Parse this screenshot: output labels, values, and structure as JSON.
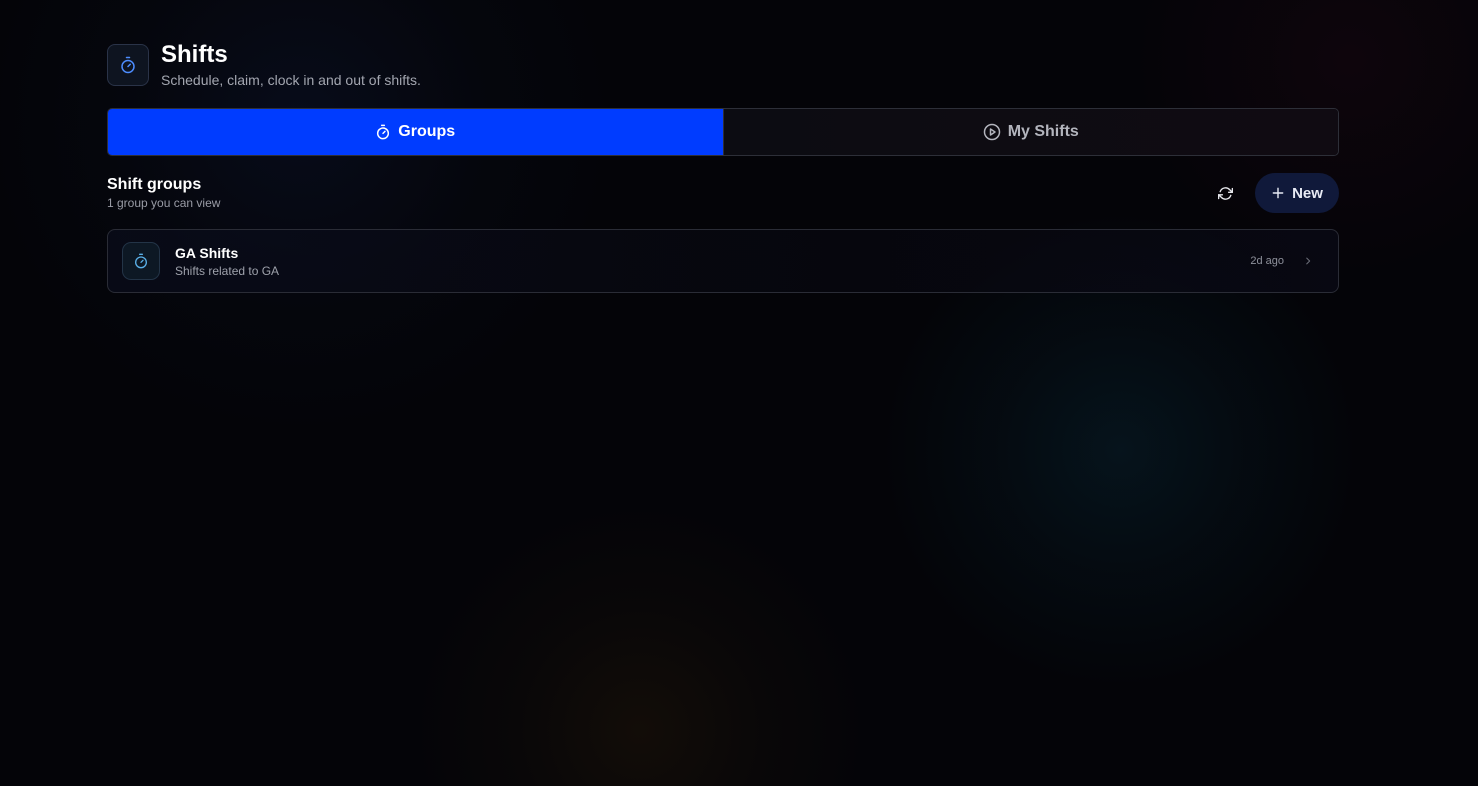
{
  "header": {
    "title": "Shifts",
    "subtitle": "Schedule, claim, clock in and out of shifts.",
    "icon": "stopwatch-icon"
  },
  "tabs": [
    {
      "label": "Groups",
      "icon": "stopwatch-icon",
      "active": true
    },
    {
      "label": "My Shifts",
      "icon": "play-circle-icon",
      "active": false
    }
  ],
  "section": {
    "title": "Shift groups",
    "subtitle": "1 group you can view",
    "refresh_icon": "refresh-icon",
    "new_label": "New",
    "new_icon": "plus-icon"
  },
  "groups": [
    {
      "title": "GA Shifts",
      "description": "Shifts related to GA",
      "time": "2d ago",
      "icon": "stopwatch-icon"
    }
  ],
  "colors": {
    "accent": "#003cff",
    "background": "#040408",
    "new_button": "#10193a",
    "icon_blue": "#4d8dff",
    "icon_teal": "#5ab0e8"
  }
}
